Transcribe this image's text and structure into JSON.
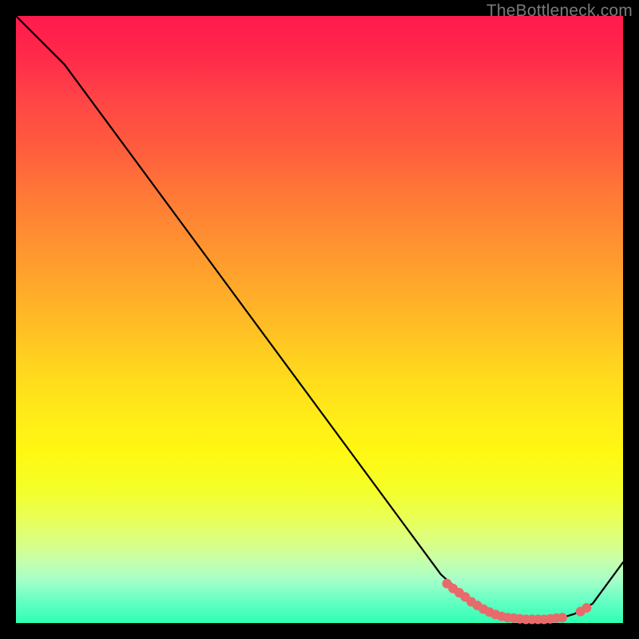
{
  "watermark": "TheBottleneck.com",
  "colors": {
    "bg": "#000000",
    "curve": "#000000",
    "marker": "#e96a6a",
    "marker_stroke": "#d55a5a"
  },
  "chart_data": {
    "type": "line",
    "title": "",
    "xlabel": "",
    "ylabel": "",
    "xlim": [
      0,
      100
    ],
    "ylim": [
      0,
      100
    ],
    "x": [
      0,
      8,
      70,
      75,
      78,
      81,
      84,
      87,
      90,
      92,
      95,
      100
    ],
    "values": [
      100,
      92,
      8,
      3.5,
      1.8,
      0.9,
      0.6,
      0.6,
      0.9,
      1.5,
      3.2,
      10
    ],
    "markers": {
      "x": [
        71,
        72,
        73,
        74,
        75,
        76,
        77,
        78,
        79,
        80,
        81,
        82,
        83,
        84,
        85,
        86,
        87,
        88,
        89,
        90,
        93,
        94
      ],
      "values": [
        6.5,
        5.7,
        5.0,
        4.3,
        3.5,
        2.9,
        2.3,
        1.8,
        1.4,
        1.1,
        0.9,
        0.8,
        0.7,
        0.6,
        0.6,
        0.6,
        0.6,
        0.7,
        0.8,
        0.9,
        1.9,
        2.5
      ]
    }
  }
}
